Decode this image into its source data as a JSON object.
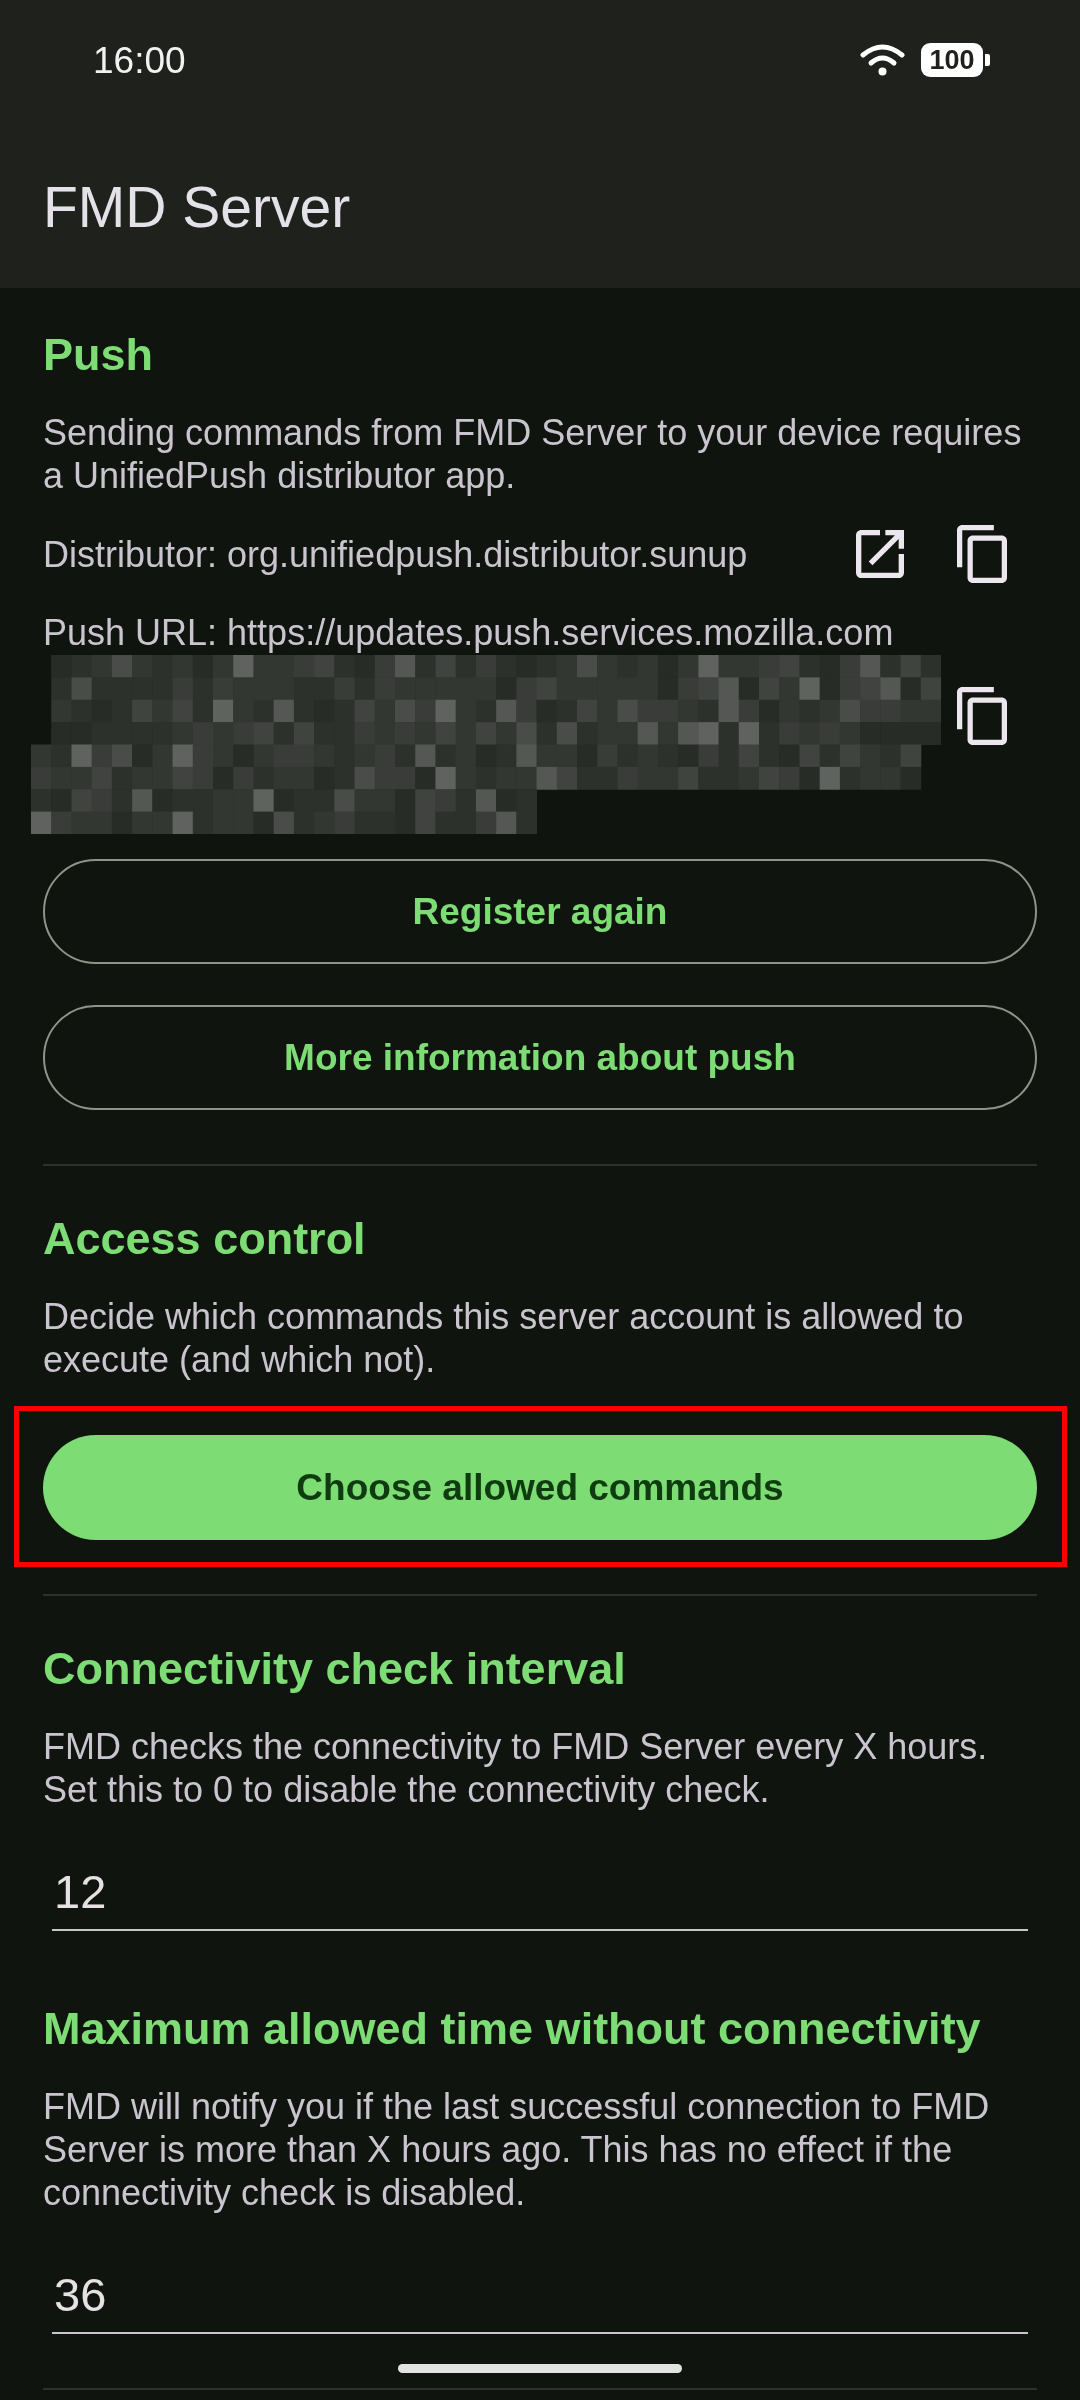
{
  "status_bar": {
    "time": "16:00",
    "battery": "100"
  },
  "app_bar": {
    "title": "FMD Server"
  },
  "sections": [
    {
      "heading": "Push",
      "description": "Sending commands from FMD Server to your device requires a UnifiedPush distributor app.",
      "rows": [
        {
          "kind": "distributor",
          "text": "Distributor: org.unifiedpush.distributor.sunup"
        },
        {
          "kind": "push_url",
          "text": "Push URL: https://updates.push.services.mozilla.com"
        }
      ],
      "buttons": [
        {
          "label": "Register again",
          "kind": "outlined",
          "highlighted": false
        },
        {
          "label": "More information about push",
          "kind": "outlined",
          "highlighted": false
        }
      ],
      "divider": true
    },
    {
      "heading": "Access control",
      "description": "Decide which commands this server account is allowed to execute (and which not).",
      "buttons": [
        {
          "label": "Choose allowed commands",
          "kind": "filled",
          "highlighted": true
        }
      ],
      "divider": true
    },
    {
      "heading": "Connectivity check interval",
      "description": "FMD checks the connectivity to FMD Server every X hours. Set this to 0 to disable the connectivity check.",
      "field": {
        "value": "12"
      },
      "divider": false
    },
    {
      "heading": "Maximum allowed time without connectivity",
      "description": "FMD will notify you if the last successful connection to FMD Server is more than X hours ago. This has no effect if the connectivity check is disabled.",
      "field": {
        "value": "36"
      },
      "divider": true
    }
  ]
}
